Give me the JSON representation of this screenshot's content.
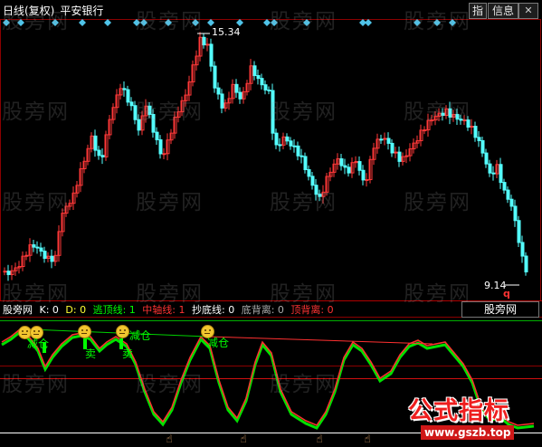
{
  "header": {
    "period_label": "日线(复权)",
    "stock_name": "平安银行"
  },
  "toolbar": {
    "zhi_label": "指",
    "info_label": "信息",
    "close_label": "✕"
  },
  "main_chart": {
    "high_price_label": "15.34",
    "low_price_label": "9.14",
    "marker_label": "q",
    "up_color": "#ff3838",
    "down_color": "#54ffff",
    "diamond_color": "#4fc3e8"
  },
  "indicator": {
    "name": "股旁网",
    "k_label": "K: 0",
    "d_label": "D: 0",
    "escape_top_label": "逃顶线: 1",
    "mid_axis_label": "中轴线: 1",
    "bottom_fish_label": "抄底线: 0",
    "bottom_divergence_label": "底背离: 0",
    "top_divergence_label": "顶背离: 0",
    "selector_value": "股旁网"
  },
  "signals": {
    "reduce_label": "减仓",
    "sell_label": "卖"
  },
  "watermark": {
    "text": "股旁网"
  },
  "stamp": {
    "title": "公式指标",
    "url": "www.gszb.top"
  }
}
